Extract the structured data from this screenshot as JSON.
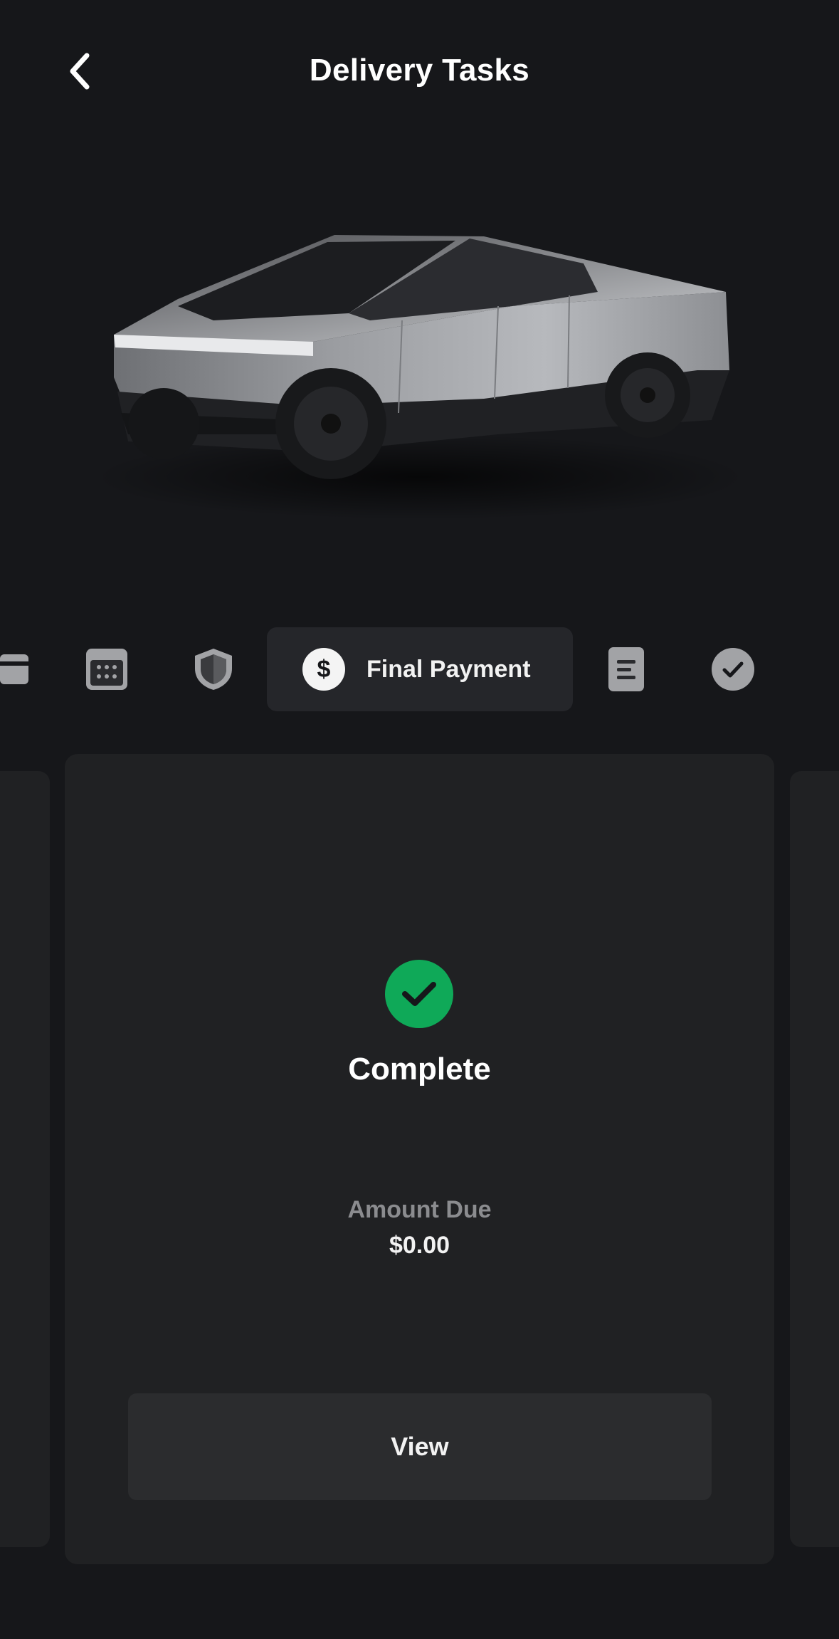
{
  "header": {
    "title": "Delivery Tasks",
    "back_icon": "chevron-left-icon"
  },
  "hero": {
    "image": "cybertruck-image"
  },
  "steps": [
    {
      "icon": "card-icon",
      "active": false
    },
    {
      "icon": "calendar-icon",
      "active": false
    },
    {
      "icon": "shield-icon",
      "active": false
    },
    {
      "icon": "dollar-icon",
      "label": "Final Payment",
      "active": true
    },
    {
      "icon": "document-icon",
      "active": false
    },
    {
      "icon": "check-circle-icon",
      "active": false
    }
  ],
  "task_card": {
    "status": "Complete",
    "status_icon": "check-icon",
    "amount_label": "Amount Due",
    "amount_value": "$0.00",
    "button_label": "View"
  },
  "colors": {
    "background": "#16171a",
    "card": "#202123",
    "success": "#0fa958",
    "muted_text": "#8b8c8f"
  }
}
